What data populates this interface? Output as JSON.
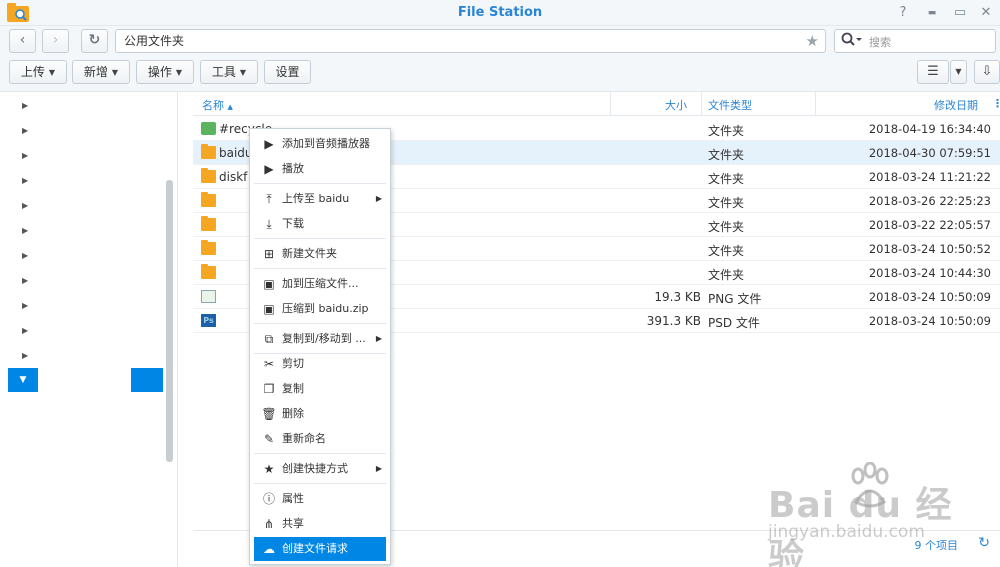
{
  "window": {
    "title": "File Station",
    "help": "?",
    "minimize": "▬",
    "maximize": "▭",
    "close": "✕"
  },
  "nav": {
    "back": "‹",
    "forward": "›",
    "refresh": "↻"
  },
  "path": {
    "value": "公用文件夹"
  },
  "search": {
    "placeholder": "搜索"
  },
  "toolbar": {
    "upload": "上传",
    "new": "新增",
    "action": "操作",
    "tools": "工具",
    "settings": "设置"
  },
  "sidebar": {
    "tree_expanders": 11,
    "selected_index": 11
  },
  "columns": {
    "name": "名称",
    "size": "大小",
    "type": "文件类型",
    "modified": "修改日期"
  },
  "files": [
    {
      "name": "#recycle",
      "size": "",
      "type": "文件夹",
      "modified": "2018-04-19 16:34:40",
      "icon": "recycle-folder-icon"
    },
    {
      "name": "baidu",
      "size": "",
      "type": "文件夹",
      "modified": "2018-04-30 07:59:51",
      "icon": "folder-icon",
      "selected": true
    },
    {
      "name": "diskf",
      "size": "",
      "type": "文件夹",
      "modified": "2018-03-24 11:21:22",
      "icon": "folder-icon"
    },
    {
      "name": "",
      "size": "",
      "type": "文件夹",
      "modified": "2018-03-26 22:25:23",
      "icon": "folder-icon"
    },
    {
      "name": "",
      "size": "",
      "type": "文件夹",
      "modified": "2018-03-22 22:05:57",
      "icon": "folder-icon"
    },
    {
      "name": "",
      "size": "",
      "type": "文件夹",
      "modified": "2018-03-24 10:50:52",
      "icon": "folder-icon"
    },
    {
      "name": "",
      "size": "",
      "type": "文件夹",
      "modified": "2018-03-24 10:44:30",
      "icon": "folder-icon"
    },
    {
      "name": "",
      "size": "19.3 KB",
      "type": "PNG 文件",
      "modified": "2018-03-24 10:50:09",
      "icon": "png-file-icon"
    },
    {
      "name": "",
      "size": "391.3 KB",
      "type": "PSD 文件",
      "modified": "2018-03-24 10:50:09",
      "icon": "psd-file-icon"
    }
  ],
  "footer": {
    "count": "9 个项目"
  },
  "context_menu": {
    "items": [
      {
        "label": "添加到音频播放器",
        "icon": "play-icon"
      },
      {
        "label": "播放",
        "icon": "play-icon"
      },
      {
        "label": "上传至 baidu",
        "icon": "upload-icon",
        "submenu": true
      },
      {
        "label": "下载",
        "icon": "download-icon"
      },
      {
        "label": "新建文件夹",
        "icon": "new-folder-icon"
      },
      {
        "label": "加到压缩文件...",
        "icon": "archive-icon"
      },
      {
        "label": "压缩到 baidu.zip",
        "icon": "zip-icon"
      },
      {
        "label": "复制到/移动到 ...",
        "icon": "copy-move-icon",
        "submenu": true
      },
      {
        "label": "剪切",
        "icon": "scissors-icon"
      },
      {
        "label": "复制",
        "icon": "copy-icon"
      },
      {
        "label": "删除",
        "icon": "trash-icon"
      },
      {
        "label": "重新命名",
        "icon": "rename-icon"
      },
      {
        "label": "创建快捷方式",
        "icon": "star-icon",
        "submenu": true
      },
      {
        "label": "属性",
        "icon": "info-icon"
      },
      {
        "label": "共享",
        "icon": "share-icon"
      },
      {
        "label": "创建文件请求",
        "icon": "cloud-upload-icon",
        "active": true
      }
    ]
  },
  "watermark": {
    "logo": "Bai du 经验",
    "url": "jingyan.baidu.com"
  },
  "colors": {
    "accent": "#2a86d5",
    "selection": "#0086e5",
    "folder": "#f5a623"
  }
}
